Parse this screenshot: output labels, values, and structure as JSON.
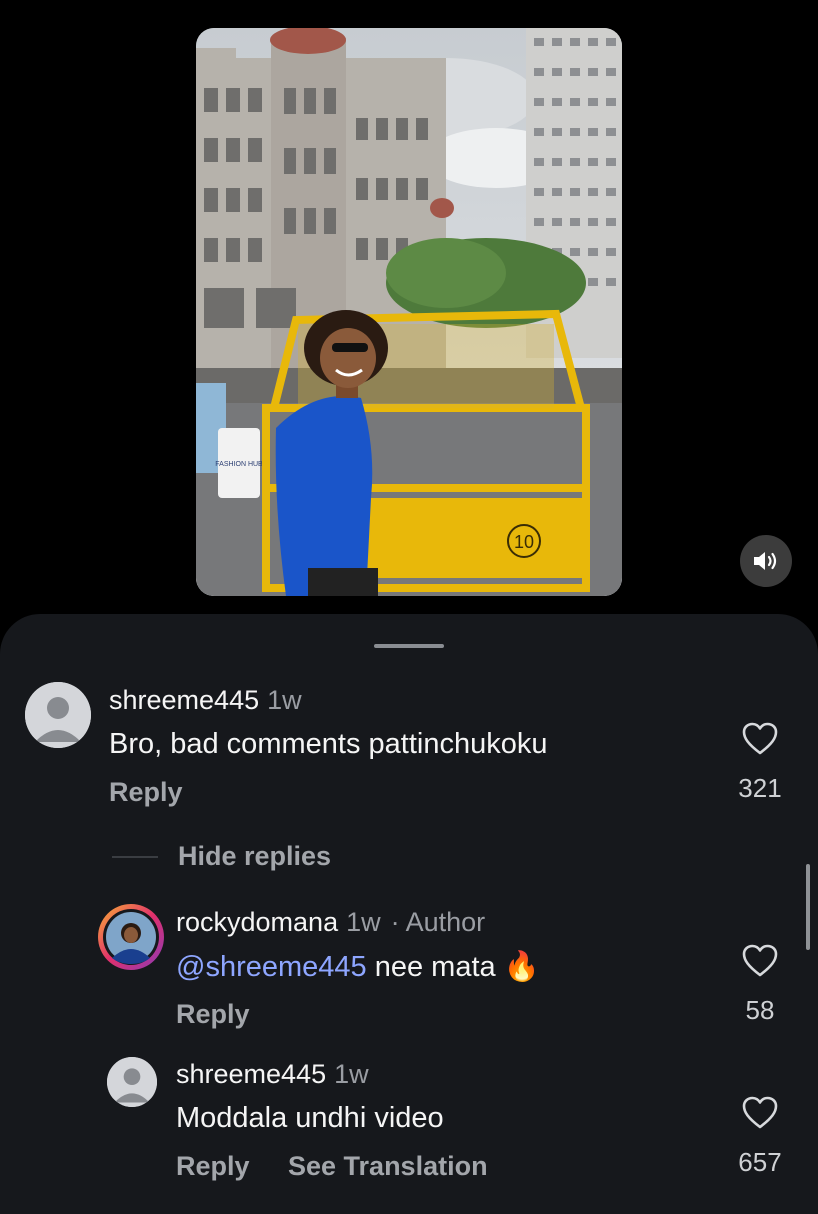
{
  "video": {
    "sign_text": "FASHION HUB",
    "barrier_number": "10"
  },
  "comments": {
    "top": {
      "username": "shreeme445",
      "time": "1w",
      "text": "Bro, bad comments pattinchukoku",
      "reply_label": "Reply",
      "likes": "321"
    },
    "hide_replies_label": "Hide replies",
    "replies": [
      {
        "username": "rockydomana",
        "time": "1w",
        "author_tag": "· Author",
        "mention": "@shreeme445",
        "text": "nee mata",
        "emoji": "🔥",
        "reply_label": "Reply",
        "likes": "58"
      },
      {
        "username": "shreeme445",
        "time": "1w",
        "text": "Moddala undhi video",
        "reply_label": "Reply",
        "translate_label": "See Translation",
        "likes": "657"
      }
    ]
  },
  "colors": {
    "sheet_bg": "#16181c",
    "mention": "#8ea6ff",
    "story_ring": "#e1306c"
  }
}
